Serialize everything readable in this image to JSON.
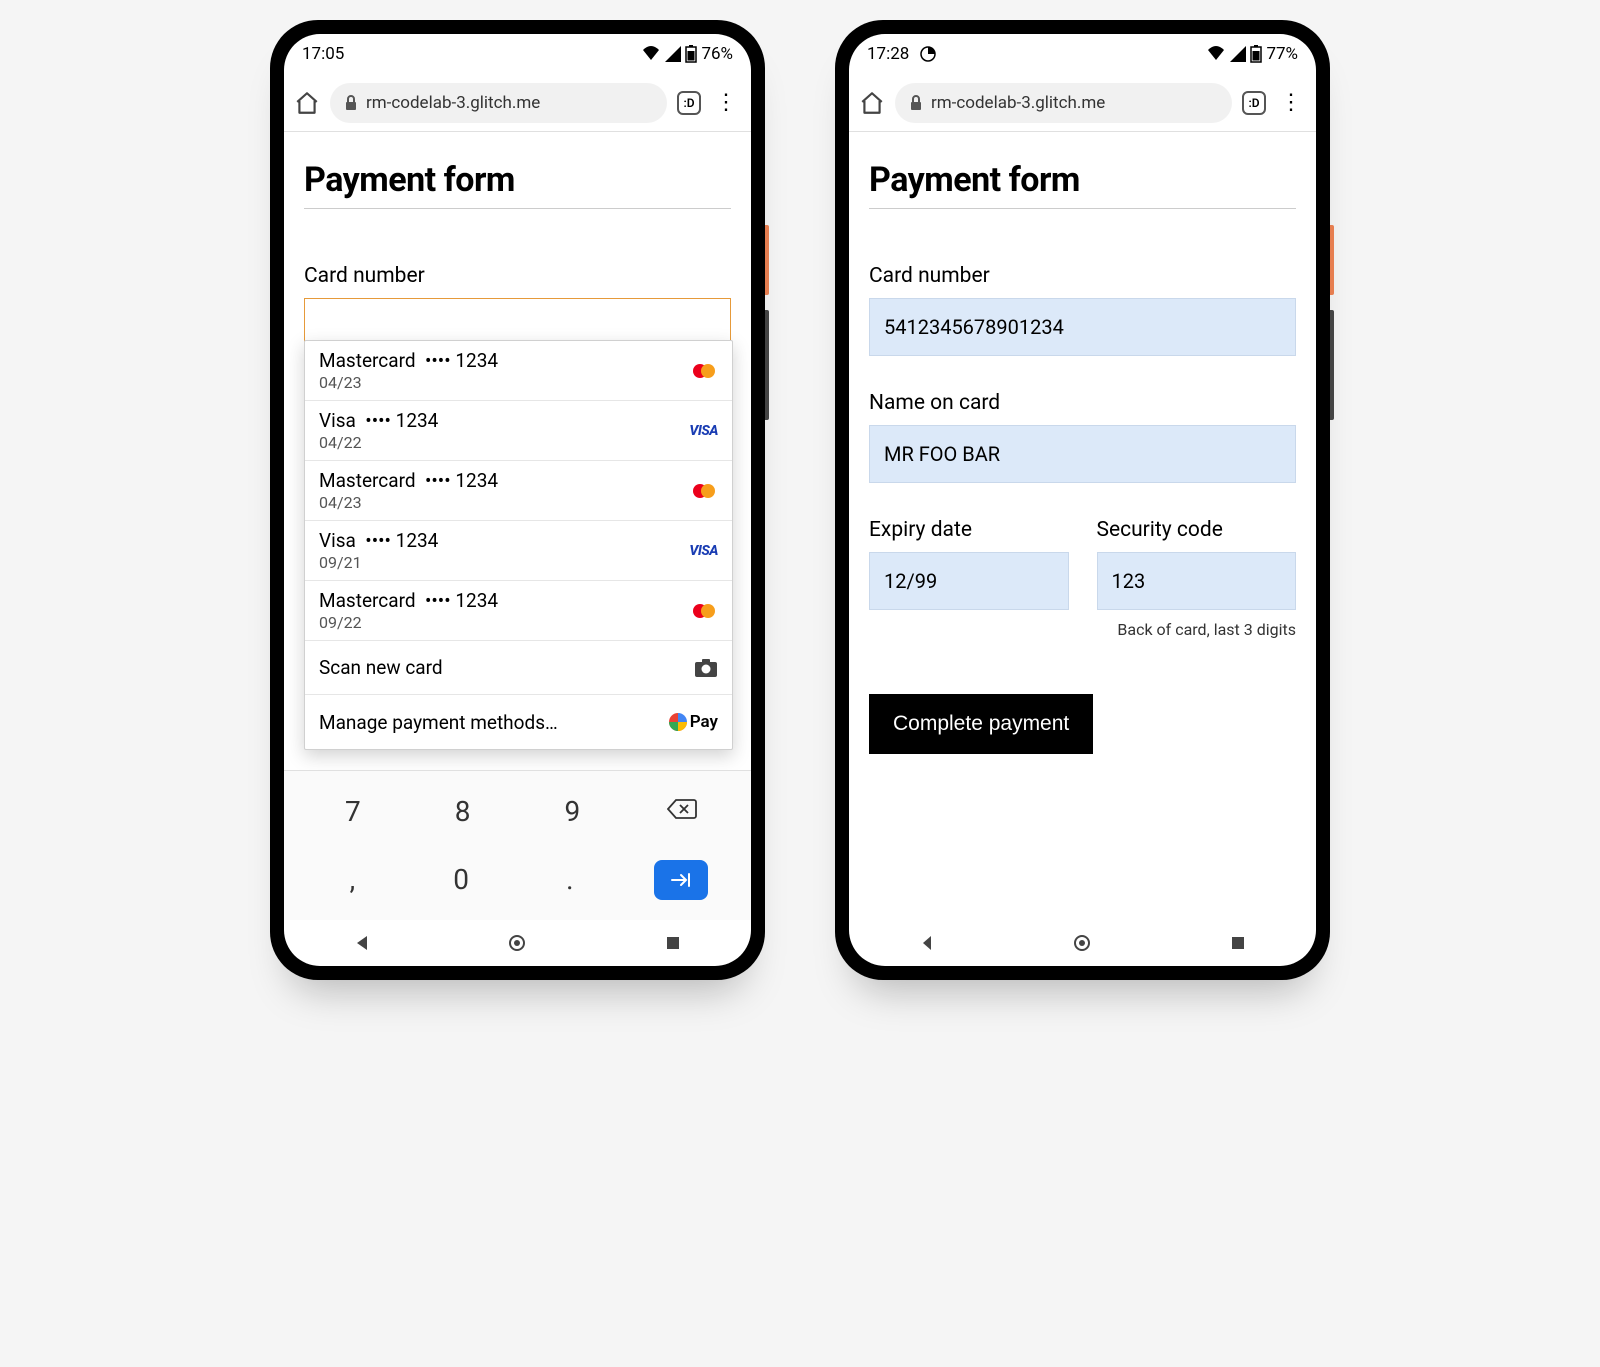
{
  "left": {
    "status": {
      "time": "17:05",
      "battery": "76%"
    },
    "browser": {
      "url": "rm-codelab-3.glitch.me",
      "tab_switcher": ":D"
    },
    "page_title": "Payment form",
    "labels": {
      "card_number": "Card number"
    },
    "autofill": {
      "cards": [
        {
          "brand": "Mastercard",
          "masked": "•••• 1234",
          "exp": "04/23",
          "logo": "mc"
        },
        {
          "brand": "Visa",
          "masked": "•••• 1234",
          "exp": "04/22",
          "logo": "visa"
        },
        {
          "brand": "Mastercard",
          "masked": "•••• 1234",
          "exp": "04/23",
          "logo": "mc"
        },
        {
          "brand": "Visa",
          "masked": "•••• 1234",
          "exp": "09/21",
          "logo": "visa"
        },
        {
          "brand": "Mastercard",
          "masked": "•••• 1234",
          "exp": "09/22",
          "logo": "mc"
        }
      ],
      "scan_label": "Scan new card",
      "manage_label": "Manage payment methods…",
      "gpay_label": "Pay"
    },
    "keyboard": {
      "r1": [
        "7",
        "8",
        "9"
      ],
      "r2": [
        ",",
        "0",
        "."
      ]
    }
  },
  "right": {
    "status": {
      "time": "17:28",
      "battery": "77%"
    },
    "browser": {
      "url": "rm-codelab-3.glitch.me",
      "tab_switcher": ":D"
    },
    "page_title": "Payment form",
    "labels": {
      "card_number": "Card number",
      "name": "Name on card",
      "expiry": "Expiry date",
      "cvc": "Security code",
      "cvc_hint": "Back of card, last 3 digits"
    },
    "values": {
      "card_number": "5412345678901234",
      "name": "MR FOO BAR",
      "expiry": "12/99",
      "cvc": "123"
    },
    "cta": "Complete payment"
  }
}
